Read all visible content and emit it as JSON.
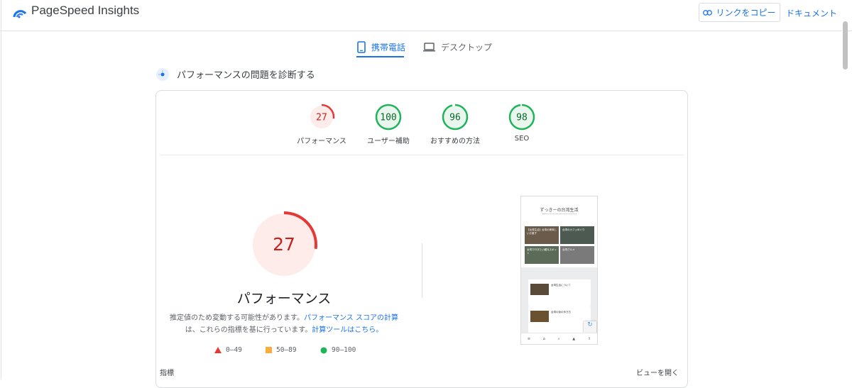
{
  "header": {
    "app_title": "PageSpeed Insights",
    "copy_link_label": "リンクをコピー",
    "docs_label": "ドキュメント"
  },
  "tabs": [
    {
      "label": "携帯電話",
      "icon": "smartphone-icon",
      "selected": true
    },
    {
      "label": "デスクトップ",
      "icon": "laptop-icon",
      "selected": false
    }
  ],
  "diagnose_title": "パフォーマンスの問題を診断する",
  "scores": [
    {
      "label": "パフォーマンス",
      "score": 27,
      "status": "fail"
    },
    {
      "label": "ユーザー補助",
      "score": 100,
      "status": "pass"
    },
    {
      "label": "おすすめの方法",
      "score": 96,
      "status": "pass"
    },
    {
      "label": "SEO",
      "score": 98,
      "status": "pass"
    }
  ],
  "main_score": {
    "value": 27,
    "title": "パフォーマンス",
    "desc_text1": "推定値のため変動する可能性があります。",
    "desc_link1": "パフォーマンス スコアの計算",
    "desc_text2": "は、これらの指標を基に行っています。",
    "desc_link2": "計算ツールはこちら。"
  },
  "legend": [
    {
      "range": "0–49",
      "shape": "triangle",
      "color": "#e53935"
    },
    {
      "range": "50–89",
      "shape": "square",
      "color": "#fbac3a"
    },
    {
      "range": "90–100",
      "shape": "circle",
      "color": "#20b45a"
    }
  ],
  "screenshot": {
    "site_title": "ずっきーの台湾生活",
    "tiles": [
      "【台湾生活】台湾の美味しいお菓子",
      "台湾のカフェめぐり",
      "台湾で行きたい観光スポット",
      "台湾グルメ"
    ],
    "posts": [
      "台湾生活について",
      "台湾の街の歩き方"
    ]
  },
  "metrics_label": "指標",
  "view_open_label": "ビューを開く",
  "colors": {
    "accent": "#1a73e8",
    "fail": "#e53935",
    "fail_bg": "#fdecea",
    "pass": "#20b45a",
    "pass_bg": "#e8f6ed"
  }
}
